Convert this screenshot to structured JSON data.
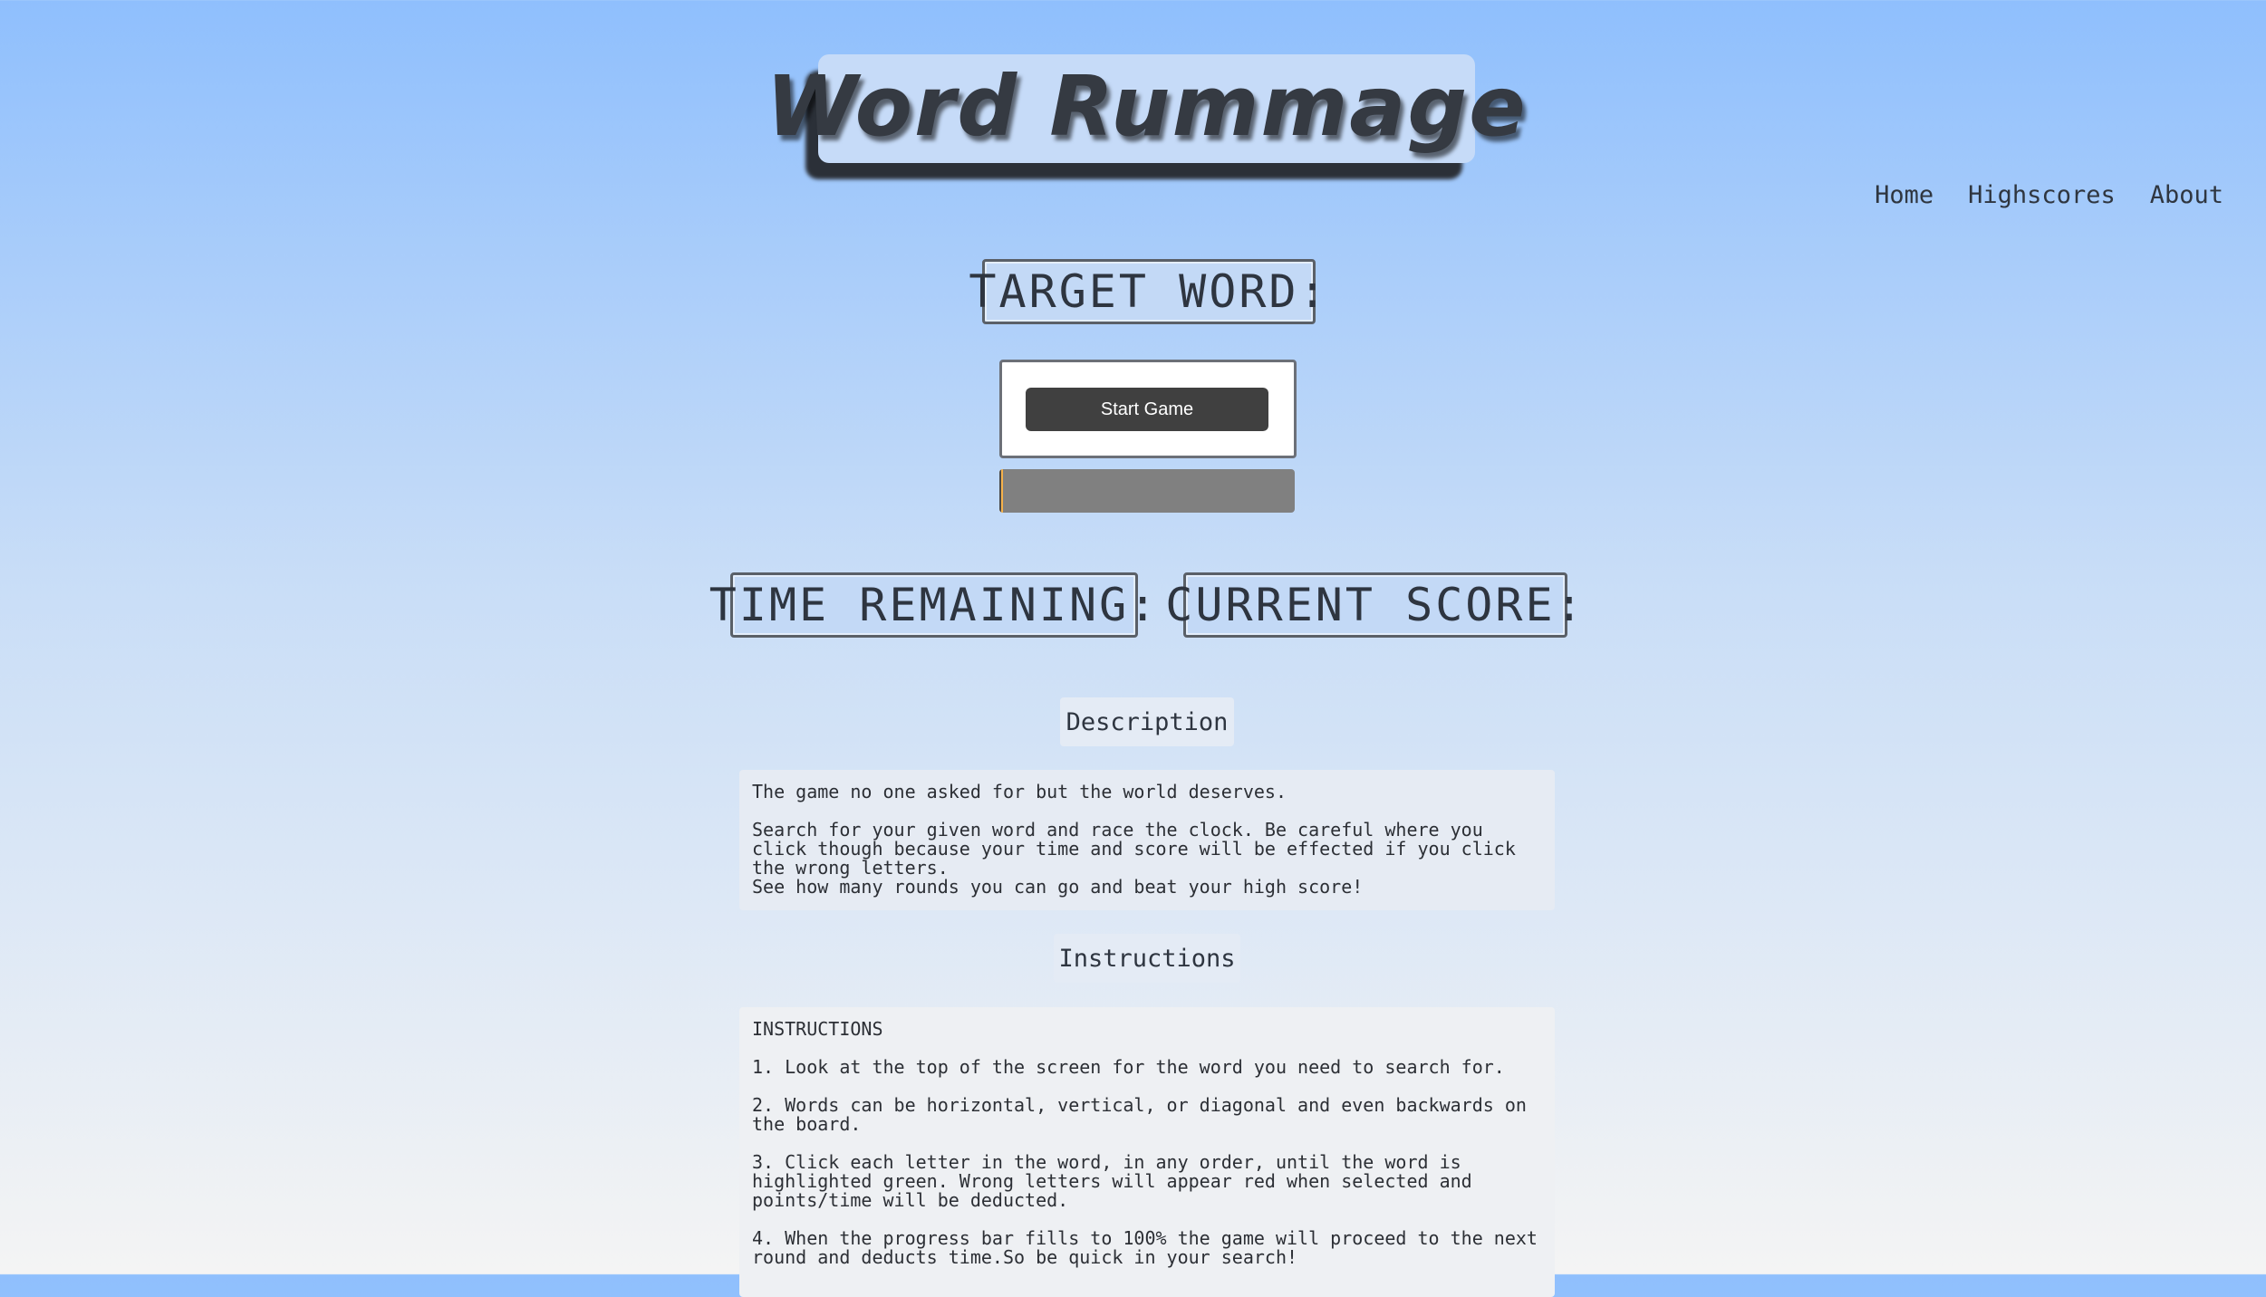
{
  "app": {
    "title": "Word Rummage"
  },
  "nav": {
    "items": [
      {
        "label": "Home"
      },
      {
        "label": "Highscores"
      },
      {
        "label": "About"
      }
    ]
  },
  "game": {
    "target_label": "TARGET WORD:",
    "start_button": "Start Game",
    "time_label": "TIME REMAINING:",
    "score_label": "CURRENT SCORE:",
    "progress_fraction": 0.01
  },
  "description": {
    "heading": "Description",
    "lines": [
      "The game no one asked for but the world deserves.",
      "Search for your given word and race the clock. Be careful where you click though because your time and score will be effected if you click the wrong letters.",
      "See how many rounds you can go and beat your high score!"
    ]
  },
  "instructions": {
    "heading": "Instructions",
    "title": "INSTRUCTIONS",
    "steps": [
      "1. Look at the top of the screen for the word you need to search for.",
      "2. Words can be horizontal, vertical, or diagonal and even backwards on the board.",
      "3. Click each letter in the word, in any order, until the word is highlighted green. Wrong letters will appear red when selected and points/time will be deducted.",
      "4. When the progress bar fills to 100% the game will proceed to the next round and deducts time.So be quick in your search!"
    ]
  },
  "colors": {
    "background_top": "#8fbffd",
    "background_bottom": "#f4f4f4",
    "start_button_bg": "#404040",
    "progress_track": "#808080",
    "progress_fill": "#f5b14a"
  }
}
